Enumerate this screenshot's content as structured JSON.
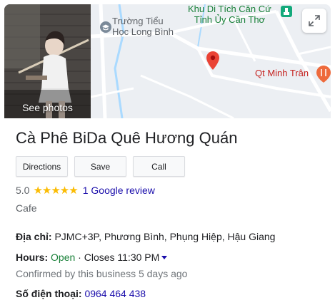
{
  "header": {
    "see_photos_label": "See photos",
    "map": {
      "labels": {
        "school_line1": "Trường Tiểu",
        "school_line2": "Học Long Bình",
        "monument_line1": "Khu Di Tích Căn Cứ",
        "monument_line2": "Tỉnh Ủy Cần Thơ",
        "restaurant": "Qt Minh Trân"
      },
      "icons": {
        "school": "graduation-cap-icon",
        "monument": "monument-icon",
        "restaurant": "fork-knife-icon",
        "pin": "map-pin-icon",
        "expand": "expand-icon"
      }
    }
  },
  "place": {
    "title": "Cà Phê BiDa Quê Hương Quán",
    "rating_value": "5.0",
    "stars": "★★★★★",
    "review_link": "1 Google review",
    "category": "Cafe"
  },
  "actions": {
    "directions": "Directions",
    "save": "Save",
    "call": "Call"
  },
  "details": {
    "address_label": "Địa chỉ:",
    "address_value": "PJMC+3P, Phương Bình, Phụng Hiệp, Hậu Giang",
    "hours_label": "Hours:",
    "hours_status": "Open",
    "hours_separator": "·",
    "hours_closes": "Closes 11:30 PM",
    "confirmed": "Confirmed by this business 5 days ago",
    "phone_label": "Số điện thoại:",
    "phone_value": "0964 464 438"
  },
  "colors": {
    "star": "#fbbc04",
    "link": "#1a0dab",
    "open": "#188038",
    "pin": "#ea4335"
  }
}
